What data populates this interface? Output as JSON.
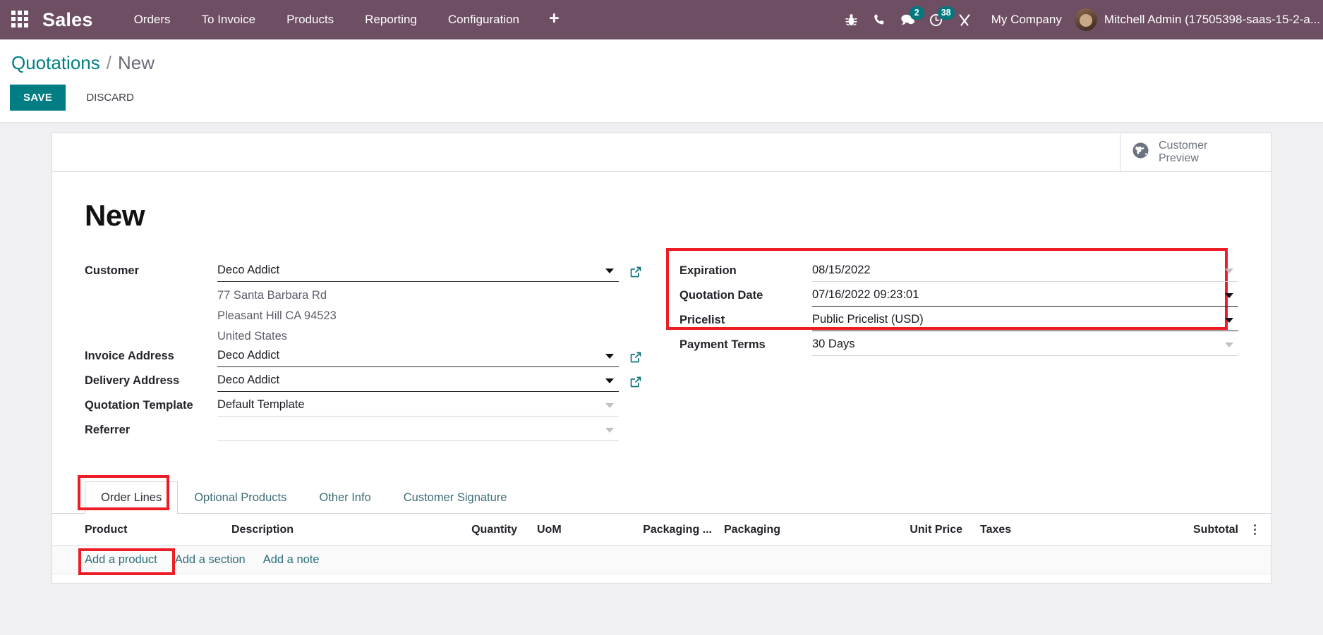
{
  "navbar": {
    "apps_icon": "apps-grid-icon",
    "brand": "Sales",
    "menu": [
      "Orders",
      "To Invoice",
      "Products",
      "Reporting",
      "Configuration"
    ],
    "plus_label": "+",
    "system_icons": [
      {
        "name": "bug-icon",
        "badge": null
      },
      {
        "name": "phone-icon",
        "badge": null
      },
      {
        "name": "messages-icon",
        "badge": "2"
      },
      {
        "name": "activities-clock-icon",
        "badge": "38"
      },
      {
        "name": "tools-icon",
        "badge": null
      }
    ],
    "company": "My Company",
    "user": "Mitchell Admin (17505398-saas-15-2-a..."
  },
  "control_panel": {
    "breadcrumb_root": "Quotations",
    "breadcrumb_sep": "/",
    "breadcrumb_current": "New",
    "save_label": "SAVE",
    "discard_label": "DISCARD"
  },
  "sheet": {
    "customer_preview": "Customer\nPreview",
    "customer_preview_line1": "Customer",
    "customer_preview_line2": "Preview",
    "record_title": "New"
  },
  "form": {
    "left": [
      {
        "label": "Customer",
        "value": "Deco Addict",
        "caret": "solid",
        "underline": "solid",
        "ext_link": true
      },
      {
        "label": "Invoice Address",
        "value": "Deco Addict",
        "caret": "solid",
        "underline": "solid",
        "ext_link": true
      },
      {
        "label": "Delivery Address",
        "value": "Deco Addict",
        "caret": "solid",
        "underline": "solid",
        "ext_link": true
      },
      {
        "label": "Quotation Template",
        "value": "Default Template",
        "caret": "dim",
        "underline": "faint",
        "ext_link": false
      },
      {
        "label": "Referrer",
        "value": "",
        "caret": "dim",
        "underline": "faint",
        "ext_link": false
      }
    ],
    "address_lines": [
      "77 Santa Barbara Rd",
      "Pleasant Hill CA 94523",
      "United States"
    ],
    "right": [
      {
        "label": "Expiration",
        "value": "08/15/2022",
        "caret": "dim",
        "underline": "faint"
      },
      {
        "label": "Quotation Date",
        "value": "07/16/2022 09:23:01",
        "caret": "solid",
        "underline": "solid"
      },
      {
        "label": "Pricelist",
        "value": "Public Pricelist (USD)",
        "caret": "solid",
        "underline": "solid"
      },
      {
        "label": "Payment Terms",
        "value": "30 Days",
        "caret": "dim",
        "underline": "faint"
      }
    ]
  },
  "notebook": {
    "tabs": [
      {
        "label": "Order Lines",
        "active": true
      },
      {
        "label": "Optional Products",
        "active": false
      },
      {
        "label": "Other Info",
        "active": false
      },
      {
        "label": "Customer Signature",
        "active": false
      }
    ],
    "columns": [
      "Product",
      "Description",
      "Quantity",
      "UoM",
      "Packaging ...",
      "Packaging",
      "Unit Price",
      "Taxes",
      "Subtotal"
    ],
    "actions": [
      "Add a product",
      "Add a section",
      "Add a note"
    ],
    "options_icon": "vertical-dots-icon"
  },
  "colors": {
    "navbar": "#6D4E63",
    "accent_teal": "#017E84",
    "badge_teal": "#00787E",
    "highlight_red": "#EC1D24",
    "page_bg": "#F0F0F2"
  }
}
